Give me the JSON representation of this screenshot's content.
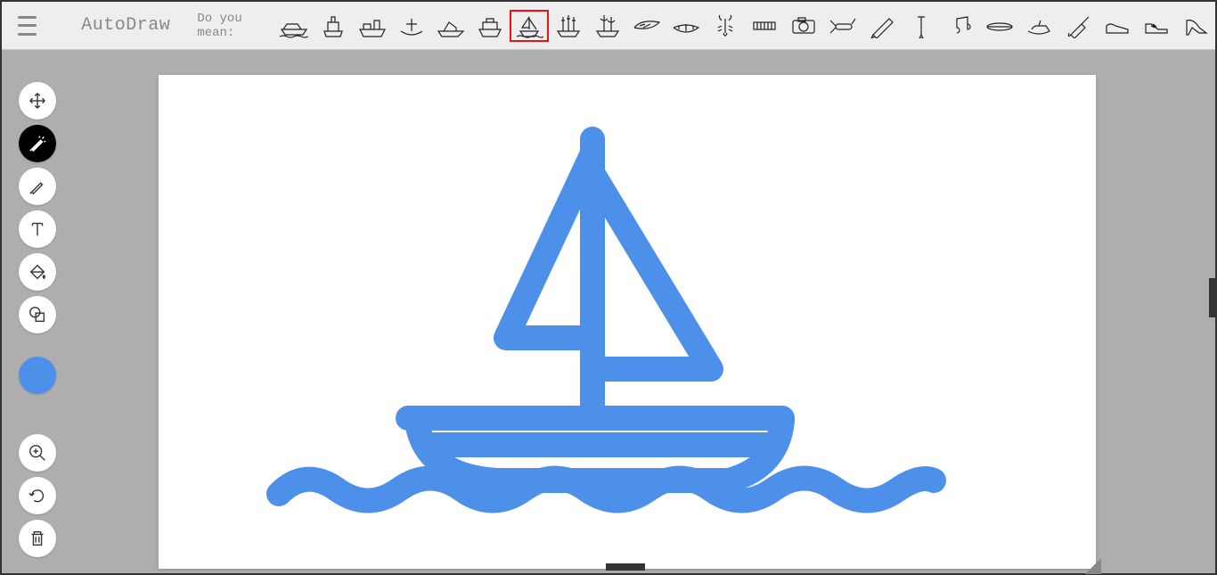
{
  "header": {
    "app_title": "AutoDraw",
    "prompt": "Do you mean:"
  },
  "suggestions": [
    {
      "name": "speedboat"
    },
    {
      "name": "ferry"
    },
    {
      "name": "cargo-ship"
    },
    {
      "name": "rowboat"
    },
    {
      "name": "yacht"
    },
    {
      "name": "cruise-ship"
    },
    {
      "name": "sailboat"
    },
    {
      "name": "galleon"
    },
    {
      "name": "tall-ship"
    },
    {
      "name": "wing"
    },
    {
      "name": "canoe"
    },
    {
      "name": "lobster"
    },
    {
      "name": "harmonica"
    },
    {
      "name": "camera"
    },
    {
      "name": "swiss-knife"
    },
    {
      "name": "pencil"
    },
    {
      "name": "nail"
    },
    {
      "name": "music-note"
    },
    {
      "name": "surfboard"
    },
    {
      "name": "jetski"
    },
    {
      "name": "brush"
    },
    {
      "name": "shoe"
    },
    {
      "name": "sneaker"
    },
    {
      "name": "heel"
    }
  ],
  "selected_suggestion_index": 6,
  "tools": {
    "select": "Select",
    "autodraw": "AutoDraw",
    "draw": "Draw",
    "text": "Type",
    "fill": "Fill",
    "shape": "Shape"
  },
  "active_tool": "autodraw",
  "current_color": "#4d90ea",
  "bottom_tools": {
    "zoom": "Zoom",
    "undo": "Undo",
    "delete": "Delete"
  },
  "canvas": {
    "drawing_name": "sailboat",
    "stroke_color": "#4d90ea"
  }
}
